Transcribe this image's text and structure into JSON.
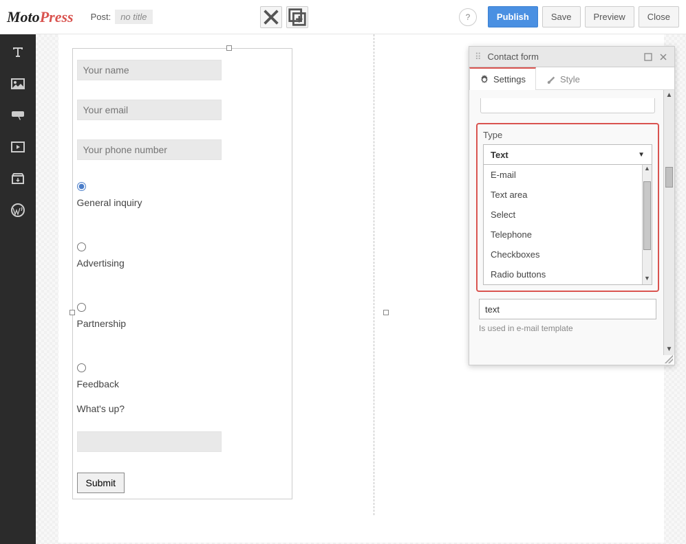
{
  "header": {
    "post_label": "Post:",
    "post_title": "no title",
    "help": "?",
    "publish": "Publish",
    "save": "Save",
    "preview": "Preview",
    "close": "Close"
  },
  "form": {
    "name_ph": "Your name",
    "email_ph": "Your email",
    "phone_ph": "Your phone number",
    "radio1": "General inquiry",
    "radio2": "Advertising",
    "radio3": "Partnership",
    "radio4": "Feedback",
    "whats_up": "What's up?",
    "submit": "Submit"
  },
  "panel": {
    "title": "Contact form",
    "tab_settings": "Settings",
    "tab_style": "Style",
    "type_label": "Type",
    "type_selected": "Text",
    "type_options": [
      "E-mail",
      "Text area",
      "Select",
      "Telephone",
      "Checkboxes",
      "Radio buttons"
    ],
    "below_value": "text",
    "helper": "Is used in e-mail template"
  }
}
